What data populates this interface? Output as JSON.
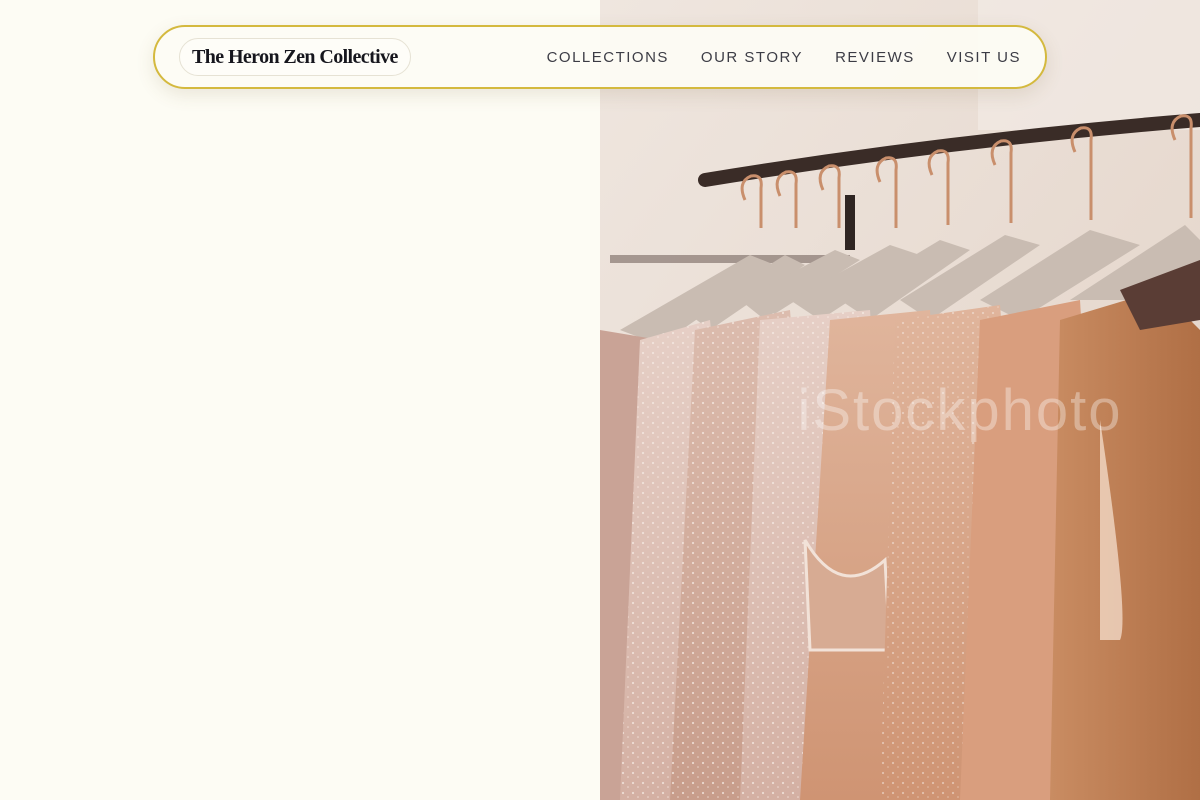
{
  "header": {
    "brand": "The Heron Zen Collective",
    "nav": [
      {
        "label": "COLLECTIONS"
      },
      {
        "label": "OUR STORY"
      },
      {
        "label": "REVIEWS"
      },
      {
        "label": "VISIT US"
      }
    ]
  },
  "hero": {
    "watermark": "iStockphoto"
  },
  "colors": {
    "background": "#fdfcf4",
    "nav_border": "#d4b93e",
    "text": "#16161d",
    "nav_text": "#3c3c45"
  }
}
